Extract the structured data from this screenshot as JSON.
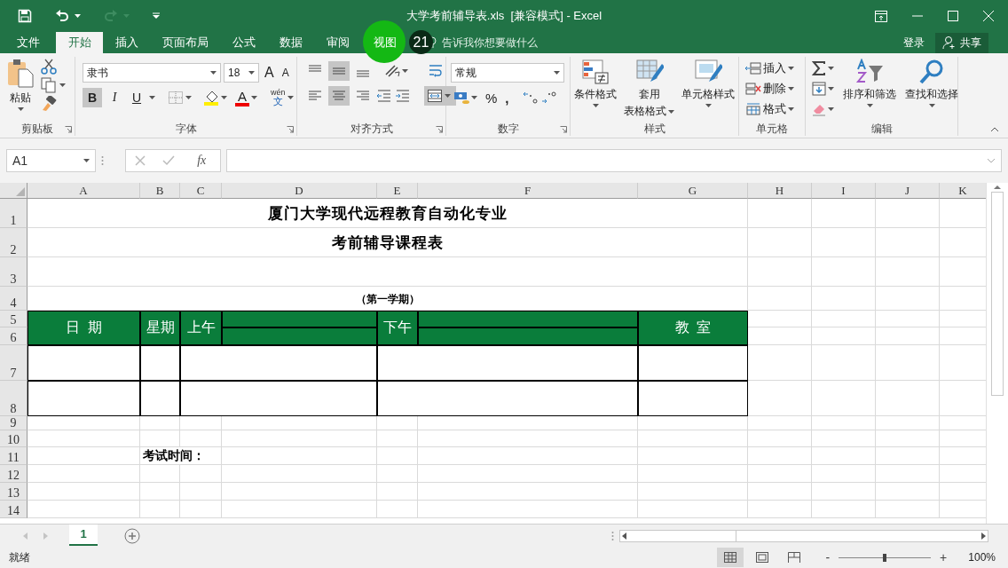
{
  "title_bar": {
    "title": "大学考前辅导表.xls  [兼容模式] - Excel"
  },
  "overlay": {
    "step": "21"
  },
  "menu_tabs": [
    {
      "label": "文件",
      "selected": false
    },
    {
      "label": "开始",
      "selected": true
    },
    {
      "label": "插入",
      "selected": false
    },
    {
      "label": "页面布局",
      "selected": false
    },
    {
      "label": "公式",
      "selected": false
    },
    {
      "label": "数据",
      "selected": false
    },
    {
      "label": "审阅",
      "selected": false
    },
    {
      "label": "视图",
      "selected": false
    }
  ],
  "tell_me": {
    "placeholder": "告诉我你想要做什么"
  },
  "account": {
    "sign_in": "登录",
    "share": "共享"
  },
  "ribbon": {
    "clipboard": {
      "label": "剪贴板",
      "paste": "粘贴"
    },
    "font": {
      "label": "字体",
      "name": "隶书",
      "size": "18",
      "grow": "A",
      "shrink": "A",
      "font_color": "A",
      "phonetic_top": "wén",
      "phonetic_bottom": "文",
      "toggles": [
        {
          "label": "B",
          "kind": "bold",
          "on": true
        },
        {
          "label": "I",
          "kind": "italic",
          "on": false
        },
        {
          "label": "U",
          "kind": "underline",
          "on": false
        }
      ]
    },
    "alignment": {
      "label": "对齐方式",
      "merge_on": true,
      "vertical": [
        {
          "kind": "top",
          "on": false
        },
        {
          "kind": "middle",
          "on": true
        },
        {
          "kind": "bottom",
          "on": false
        }
      ],
      "horizontal": [
        {
          "kind": "left",
          "on": false
        },
        {
          "kind": "center",
          "on": true
        },
        {
          "kind": "right",
          "on": false
        }
      ]
    },
    "number": {
      "label": "数字",
      "format": "常规",
      "percent": "%",
      "comma": ","
    },
    "styles": {
      "label": "样式",
      "buttons": [
        {
          "kind": "conditional",
          "label": "条件格式"
        },
        {
          "kind": "table",
          "label": "套用",
          "label2": "表格格式"
        },
        {
          "kind": "cell",
          "label": "单元格样式"
        }
      ]
    },
    "cells": {
      "label": "单元格",
      "buttons": [
        {
          "kind": "insert",
          "label": "插入"
        },
        {
          "kind": "delete",
          "label": "删除"
        },
        {
          "kind": "format",
          "label": "格式"
        }
      ]
    },
    "editing": {
      "label": "编辑",
      "buttons": [
        {
          "kind": "sort",
          "label": "排序和筛选"
        },
        {
          "kind": "find",
          "label": "查找和选择"
        }
      ]
    }
  },
  "name_box": {
    "value": "A1"
  },
  "formula_bar": {
    "function_label": "fx"
  },
  "sheet": {
    "columns": [
      "A",
      "B",
      "C",
      "D",
      "E",
      "F",
      "G",
      "H",
      "I",
      "J",
      "K"
    ],
    "rows": [
      "1",
      "2",
      "3",
      "4",
      "5",
      "6",
      "7",
      "8",
      "9",
      "10",
      "11",
      "12",
      "13",
      "14"
    ],
    "title": "厦门大学现代远程教育自动化专业",
    "subtitle": "考前辅导课程表",
    "term": "（第一学期）",
    "headers": [
      "日  期",
      "星期",
      "上午",
      "下午",
      "教  室"
    ],
    "exam_label": "考试时间："
  },
  "sheet_tabs": [
    {
      "label": "1",
      "selected": true
    }
  ],
  "status_bar": {
    "status": "就绪",
    "views": [
      {
        "kind": "normal",
        "selected": true
      },
      {
        "kind": "page_layout",
        "selected": false
      },
      {
        "kind": "page_break",
        "selected": false
      }
    ],
    "zoom_out": "-",
    "zoom_in": "+",
    "zoom_slider": {
      "level": 0.5
    },
    "zoom": "100%"
  }
}
